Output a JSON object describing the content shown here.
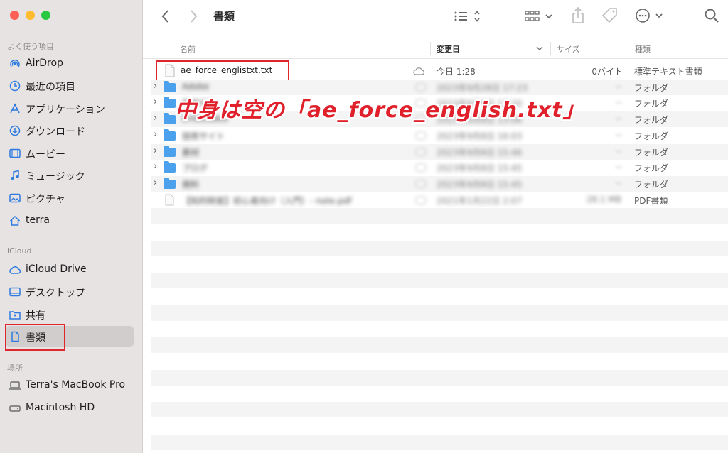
{
  "window": {
    "title": "書類"
  },
  "sidebar": {
    "favorites_title": "よく使う項目",
    "favorites": [
      {
        "label": "AirDrop",
        "icon": "airdrop-icon"
      },
      {
        "label": "最近の項目",
        "icon": "clock-icon"
      },
      {
        "label": "アプリケーション",
        "icon": "applications-icon"
      },
      {
        "label": "ダウンロード",
        "icon": "download-icon"
      },
      {
        "label": "ムービー",
        "icon": "movie-icon"
      },
      {
        "label": "ミュージック",
        "icon": "music-icon"
      },
      {
        "label": "ピクチャ",
        "icon": "picture-icon"
      },
      {
        "label": "terra",
        "icon": "home-icon"
      }
    ],
    "icloud_title": "iCloud",
    "icloud": [
      {
        "label": "iCloud Drive",
        "icon": "cloud-icon"
      },
      {
        "label": "デスクトップ",
        "icon": "desktop-icon"
      },
      {
        "label": "共有",
        "icon": "shared-folder-icon"
      },
      {
        "label": "書類",
        "icon": "document-icon",
        "selected": true
      }
    ],
    "locations_title": "場所",
    "locations": [
      {
        "label": "Terra's MacBook Pro",
        "icon": "laptop-icon"
      },
      {
        "label": "Macintosh HD",
        "icon": "disk-icon"
      }
    ]
  },
  "columns": {
    "name": "名前",
    "date": "変更日",
    "size": "サイズ",
    "kind": "種類"
  },
  "files": [
    {
      "name": "ae_force_englistxt.txt",
      "date": "今日 1:28",
      "size": "0バイト",
      "kind": "標準テキスト書類",
      "type": "file",
      "cloud": true
    },
    {
      "name": "Adobe",
      "date": "2023年9月28日 17:23",
      "size": "--",
      "kind": "フォルダ",
      "type": "folder"
    },
    {
      "name": "Arduino",
      "date": "2023年9月8日 17:20",
      "size": "--",
      "kind": "フォルダ",
      "type": "folder"
    },
    {
      "name": "Embedded",
      "date": "2023年9月8日 13:06",
      "size": "--",
      "kind": "フォルダ",
      "type": "folder"
    },
    {
      "name": "技術サイト",
      "date": "2023年9月8日 16:03",
      "size": "--",
      "kind": "フォルダ",
      "type": "folder"
    },
    {
      "name": "素材",
      "date": "2023年9月8日 15:46",
      "size": "--",
      "kind": "フォルダ",
      "type": "folder"
    },
    {
      "name": "ブログ",
      "date": "2023年9月8日 15:45",
      "size": "--",
      "kind": "フォルダ",
      "type": "folder"
    },
    {
      "name": "資料",
      "date": "2023年9月8日 15:45",
      "size": "--",
      "kind": "フォルダ",
      "type": "folder"
    },
    {
      "name": "【知的財産】初心者向け（入門）- note.pdf",
      "date": "2021年1月22日 2:07",
      "size": "28.1 MB",
      "kind": "PDF書類",
      "type": "pdf"
    }
  ],
  "annotation": "中身は空の「ae_force_english.txt」"
}
